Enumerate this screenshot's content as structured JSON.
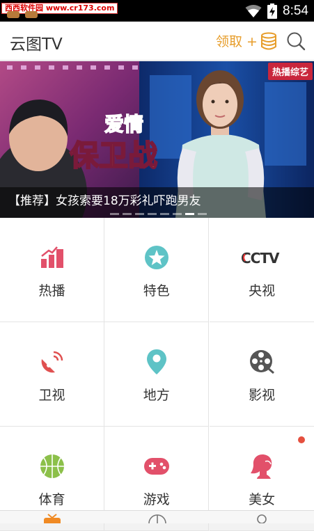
{
  "status_bar": {
    "watermark": "西西软件园 www.cr173.com",
    "time": "8:54",
    "icons": [
      "wifi-icon",
      "battery-charging-icon"
    ]
  },
  "app_bar": {
    "title": "云图TV",
    "claim_label": "领取 +",
    "claim_icon": "coins-icon",
    "search_icon": "search-icon"
  },
  "banner": {
    "badge": "热播综艺",
    "caption": "【推荐】女孩索要18万彩礼吓跑男友",
    "show_logo_line1": "爱情",
    "show_logo_line2": "保卫战",
    "slide_count": 8,
    "active_slide": 6
  },
  "categories": [
    {
      "label": "热播",
      "icon": "hot-chart-icon",
      "color": "#e2506a"
    },
    {
      "label": "特色",
      "icon": "star-badge-icon",
      "color": "#5ec3c6"
    },
    {
      "label": "央视",
      "icon": "cctv-logo-icon",
      "color": "#333333"
    },
    {
      "label": "卫视",
      "icon": "satellite-dish-icon",
      "color": "#e05050"
    },
    {
      "label": "地方",
      "icon": "map-pin-icon",
      "color": "#5ec3c6"
    },
    {
      "label": "影视",
      "icon": "film-reel-icon",
      "color": "#555555"
    },
    {
      "label": "体育",
      "icon": "basketball-icon",
      "color": "#8cc04a"
    },
    {
      "label": "游戏",
      "icon": "gamepad-icon",
      "color": "#e2506a"
    },
    {
      "label": "美女",
      "icon": "woman-profile-icon",
      "color": "#e2506a",
      "new": true
    }
  ],
  "tab_bar": {
    "tabs": [
      "tv-icon",
      "compass-icon",
      "user-icon"
    ],
    "active_tab": 0,
    "accent": "#f08a24"
  }
}
